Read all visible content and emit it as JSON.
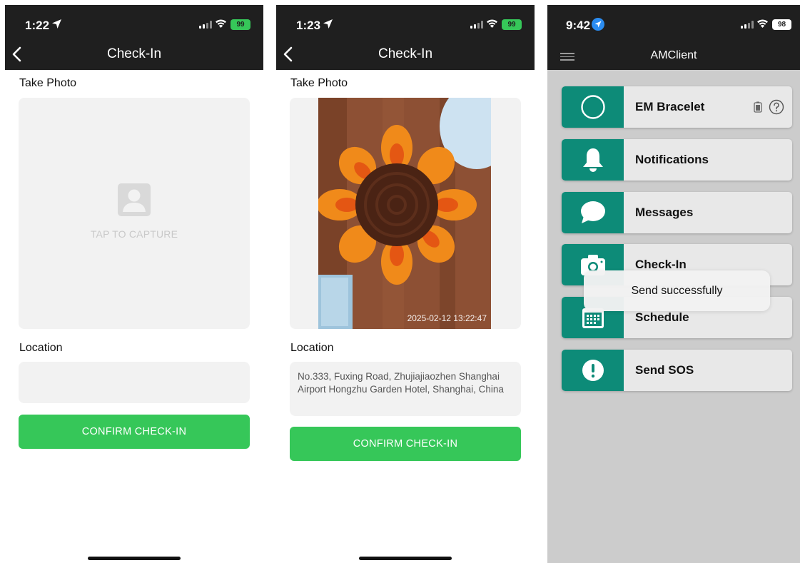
{
  "screen1": {
    "status": {
      "time": "1:22",
      "battery": "99"
    },
    "nav_title": "Check-In",
    "take_photo_label": "Take Photo",
    "tap_to_capture": "TAP TO CAPTURE",
    "location_label": "Location",
    "location_value": "",
    "confirm_label": "CONFIRM CHECK-IN"
  },
  "screen2": {
    "status": {
      "time": "1:23",
      "battery": "99"
    },
    "nav_title": "Check-In",
    "take_photo_label": "Take Photo",
    "photo_timestamp": "2025-02-12 13:22:47",
    "location_label": "Location",
    "location_value": "No.333, Fuxing Road, Zhujiajiaozhen Shanghai Airport Hongzhu Garden Hotel, Shanghai, China",
    "confirm_label": "CONFIRM CHECK-IN"
  },
  "screen3": {
    "status": {
      "time": "9:42",
      "battery": "98"
    },
    "app_title": "AMClient",
    "menu": [
      {
        "label": "EM Bracelet",
        "icon": "circle-icon"
      },
      {
        "label": "Notifications",
        "icon": "bell-icon"
      },
      {
        "label": "Messages",
        "icon": "chat-bubble-icon"
      },
      {
        "label": "Check-In",
        "icon": "camera-icon"
      },
      {
        "label": "Schedule",
        "icon": "calendar-icon"
      },
      {
        "label": "Send SOS",
        "icon": "exclamation-icon"
      }
    ],
    "toast": "Send successfully"
  },
  "colors": {
    "accent_teal": "#0d8b78",
    "confirm_green": "#36c759",
    "status_bar": "#1f1f1f"
  }
}
